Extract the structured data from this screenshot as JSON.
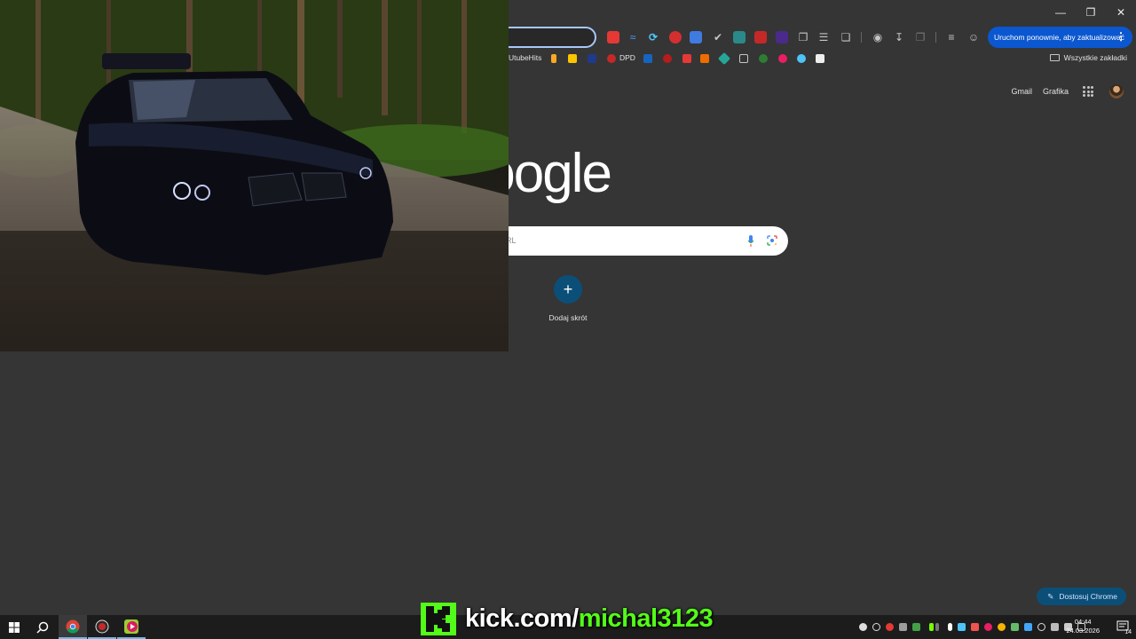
{
  "window": {
    "minimize_icon": "minimize-icon",
    "restore_icon": "restore-icon",
    "close_icon": "close-icon"
  },
  "toolbar": {
    "update_button": "Uruchom ponownie, aby zaktualizować",
    "menu_icon": "kebab-menu-icon"
  },
  "bookmarks": {
    "items": [
      {
        "label": "UtubeHits"
      },
      {
        "label": "DPD"
      }
    ],
    "all_bookmarks": "Wszystkie zakładki"
  },
  "ntp": {
    "gmail": "Gmail",
    "images": "Grafika",
    "logo": "Google",
    "search_placeholder": "RL",
    "add_shortcut": "Dodaj skrót",
    "customize": "Dostosuj Chrome"
  },
  "taskbar": {
    "time": "04:44",
    "date": "24.03.2026",
    "notifications_count": "14"
  },
  "watermark": {
    "domain": "kick.com/",
    "user": "michal3123"
  },
  "colors": {
    "background": "#353535",
    "accent_blue": "#0b57d0",
    "kick_green": "#53fc18"
  }
}
